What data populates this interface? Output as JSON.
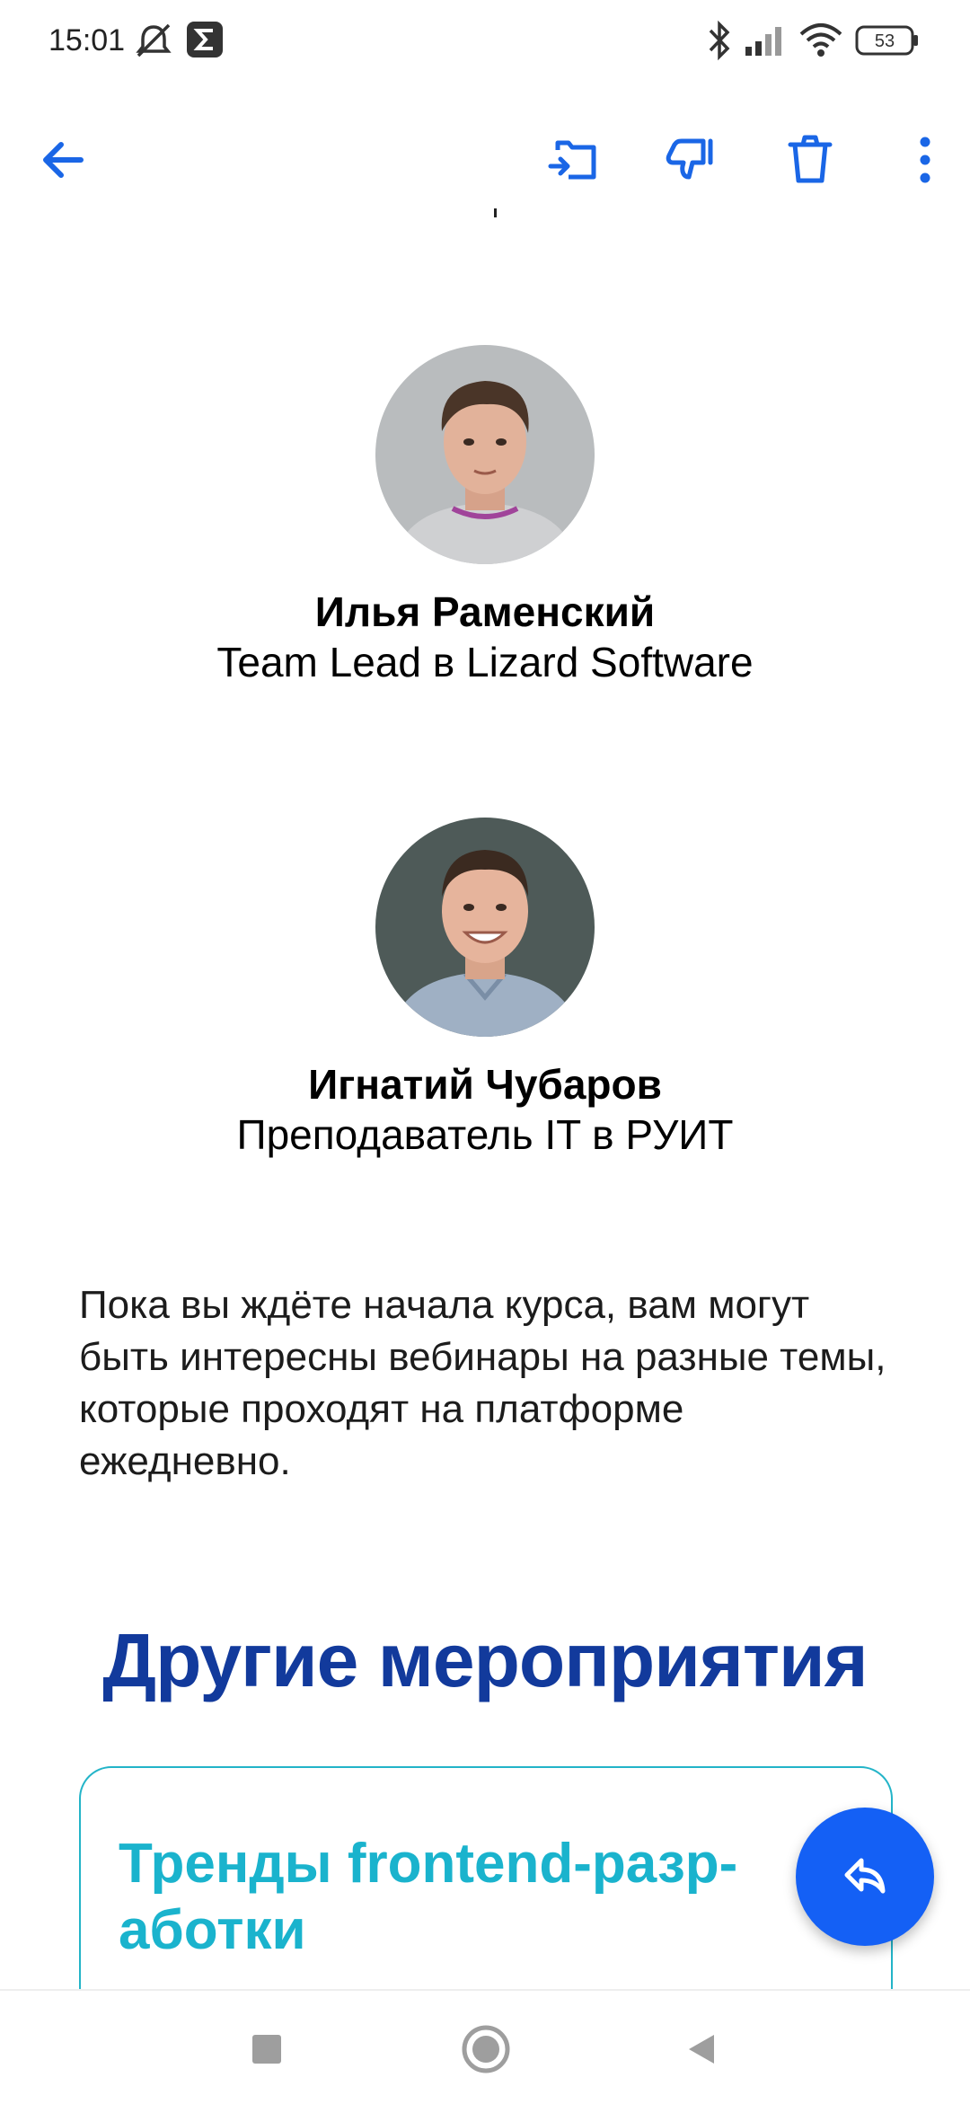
{
  "status_bar": {
    "time": "15:01",
    "battery": "53",
    "icons": [
      "mute-alarm-icon",
      "sigma-app-icon",
      "bluetooth-icon",
      "signal-icon",
      "wifi-icon",
      "battery-icon"
    ]
  },
  "toolbar": {
    "back": "back-arrow-icon",
    "move": "move-to-folder-icon",
    "spam": "spam-icon",
    "delete": "trash-icon",
    "more": "more-vertical-icon",
    "accent": "#1a66e6"
  },
  "speakers": [
    {
      "name": "Илья Раменский",
      "role": "Team Lead в Lizard Software"
    },
    {
      "name": "Игнатий Чубаров",
      "role": "Преподаватель IT в РУИТ"
    }
  ],
  "body_text": "Пока вы ждёте начала курса, вам могут быть интересны вебинары на разные темы, которые проходят на платформе ежедневно.",
  "section_title": "Другие мероприятия",
  "card": {
    "title": "Тренды frontend-разр-аботки",
    "title_line1": "Тренды frontend-разр-",
    "title_line2": "аботки"
  },
  "fab": {
    "icon": "reply-icon",
    "color": "#1460f5"
  },
  "nav_bar": {
    "icons": [
      "recents-square-icon",
      "home-circle-icon",
      "back-triangle-icon"
    ]
  }
}
